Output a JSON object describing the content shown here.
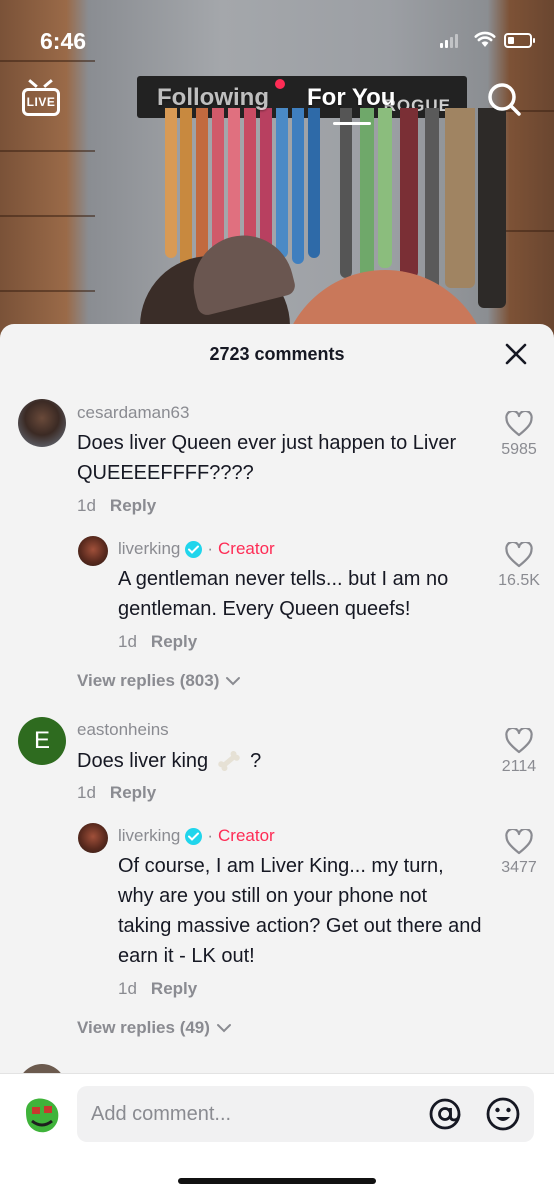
{
  "status_bar": {
    "time": "6:46"
  },
  "top_nav": {
    "live_label": "LIVE",
    "tab_following": "Following",
    "tab_for_you": "For You",
    "gym_sign": "ROGUE",
    "accent_color": "#fe2c55"
  },
  "comments_header": {
    "count_text": "2723 comments"
  },
  "comments": [
    {
      "username": "cesardaman63",
      "text": "Does liver Queen ever just happen to Liver QUEEEEFFFF????",
      "age": "1d",
      "reply_label": "Reply",
      "likes": "5985",
      "reply": {
        "username": "liverking",
        "separator": "·",
        "creator_label": "Creator",
        "text": "A gentleman never tells... but I am no gentleman. Every Queen queefs!",
        "age": "1d",
        "reply_label": "Reply",
        "likes": "16.5K"
      },
      "view_replies": "View replies (803)"
    },
    {
      "username": "eastonheins",
      "avatar_letter": "E",
      "text_before": "Does liver king",
      "text_after": "?",
      "emoji": "bone",
      "age": "1d",
      "reply_label": "Reply",
      "likes": "2114",
      "reply": {
        "username": "liverking",
        "separator": "·",
        "creator_label": "Creator",
        "text": "Of course, I am Liver King... my turn, why are you still on your phone not taking massive action? Get out there and earn it - LK out!",
        "age": "1d",
        "reply_label": "Reply",
        "likes": "3477"
      },
      "view_replies": "View replies (49)"
    }
  ],
  "composer": {
    "placeholder": "Add comment..."
  },
  "icons": [
    "live-icon",
    "search-icon",
    "close-icon",
    "heart-icon",
    "verified-icon",
    "chevron-down-icon",
    "at-icon",
    "emoji-icon",
    "bone-emoji"
  ]
}
